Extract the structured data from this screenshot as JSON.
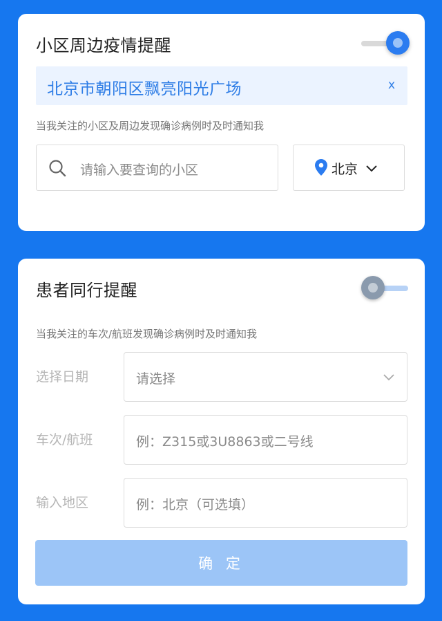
{
  "community_alert": {
    "title": "小区周边疫情提醒",
    "toggle_on": true,
    "selected_community": "北京市朝阳区飘亮阳光广场",
    "remove_label": "x",
    "hint": "当我关注的小区及周边发现确诊病例时及时通知我",
    "search_placeholder": "请输入要查询的小区",
    "city": "北京",
    "icons": {
      "search": "search-icon",
      "location": "location-pin-icon",
      "dropdown": "chevron-down-icon"
    }
  },
  "patient_alert": {
    "title": "患者同行提醒",
    "toggle_on": false,
    "hint": "当我关注的车次/航班发现确诊病例时及时通知我",
    "date_label": "选择日期",
    "date_placeholder": "请选择",
    "train_label": "车次/航班",
    "train_placeholder": "例：Z315或3U8863或二号线",
    "region_label": "输入地区",
    "region_placeholder": "例：北京（可选填）",
    "confirm_label": "确 定"
  },
  "colors": {
    "background": "#1677ef",
    "accent": "#2b7cf0",
    "selected_bg": "#ebf3ff",
    "confirm_disabled": "#9cc5f7"
  }
}
